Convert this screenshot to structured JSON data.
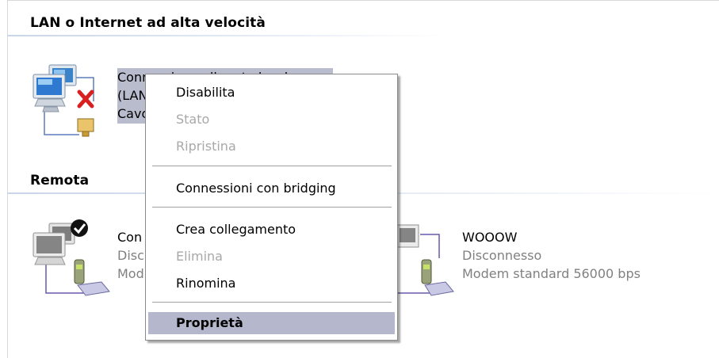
{
  "groups": {
    "lan_title": "LAN o Internet ad alta velocità",
    "remote_title": "Remota"
  },
  "lan_connection": {
    "line1": "Connessione alla rete locale",
    "line2": "(LAN)",
    "line3": "Cavo di rete scollegato"
  },
  "remote_connection_1": {
    "line1": "Con",
    "line2": "Disc",
    "line3": "Mod"
  },
  "remote_connection_2": {
    "name": "WOOOW",
    "status": "Disconnesso",
    "device": "Modem standard 56000 bps"
  },
  "context_menu": {
    "items": [
      {
        "label": "Disabilita",
        "enabled": true
      },
      {
        "label": "Stato",
        "enabled": false
      },
      {
        "label": "Ripristina",
        "enabled": false
      },
      {
        "label": "Connessioni con bridging",
        "enabled": true
      },
      {
        "label": "Crea collegamento",
        "enabled": true
      },
      {
        "label": "Elimina",
        "enabled": false
      },
      {
        "label": "Rinomina",
        "enabled": true
      },
      {
        "label": "Proprietà",
        "enabled": true,
        "default": true,
        "highlighted": true
      }
    ]
  },
  "colors": {
    "selection": "#b9bccd",
    "menu_highlight": "#b5b7cc",
    "disabled_text": "#a8a8a8",
    "secondary_text": "#808080"
  }
}
